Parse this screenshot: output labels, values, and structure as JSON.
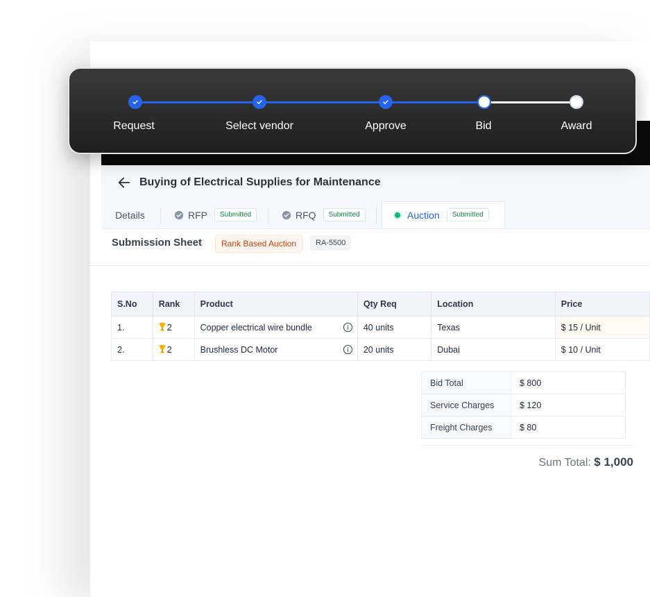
{
  "stepper": {
    "steps": [
      {
        "label": "Request",
        "state": "done"
      },
      {
        "label": "Select vendor",
        "state": "done"
      },
      {
        "label": "Approve",
        "state": "done"
      },
      {
        "label": "Bid",
        "state": "current"
      },
      {
        "label": "Award",
        "state": "pending"
      }
    ],
    "accent": "#2563eb"
  },
  "header": {
    "title": "Buying of Electrical Supplies for Maintenance"
  },
  "tabs": [
    {
      "label": "Details"
    },
    {
      "label": "RFP",
      "badge": "Submitted"
    },
    {
      "label": "RFQ",
      "badge": "Submitted"
    },
    {
      "label": "Auction",
      "badge": "Submitted",
      "active": true
    }
  ],
  "submission": {
    "title": "Submission Sheet",
    "type_chip": "Rank Based Auction",
    "id_chip": "RA-5500"
  },
  "table": {
    "headers": [
      "S.No",
      "Rank",
      "Product",
      "Qty Req",
      "Location",
      "Price"
    ],
    "rows": [
      {
        "sno": "1.",
        "rank": "2",
        "product": "Copper electrical wire bundle",
        "qty": "40 units",
        "location": "Texas",
        "price": "$ 15 / Unit"
      },
      {
        "sno": "2.",
        "rank": "2",
        "product": "Brushless DC Motor",
        "qty": "20 units",
        "location": "Dubai",
        "price": "$ 10 / Unit"
      }
    ]
  },
  "summary": {
    "rows": [
      {
        "label": "Bid Total",
        "value": "$ 800"
      },
      {
        "label": "Service Charges",
        "value": "$ 120"
      },
      {
        "label": "Freight Charges",
        "value": "$ 80"
      }
    ],
    "total_label": "Sum Total:",
    "total_value": "$ 1,000"
  }
}
